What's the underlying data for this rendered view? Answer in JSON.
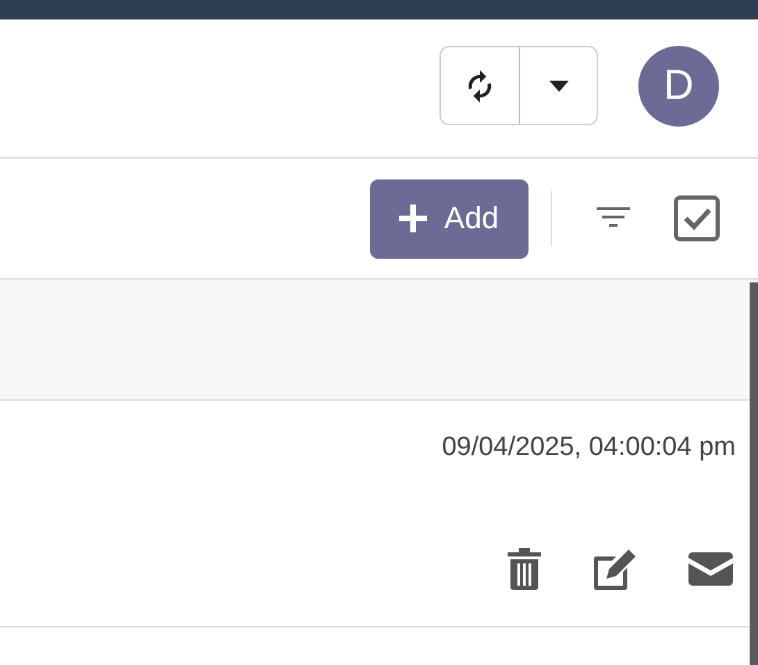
{
  "header": {
    "avatar": "D"
  },
  "toolbar": {
    "add_button": "Add"
  },
  "table": {
    "rows": [
      {
        "timestamp": "09/04/2025, 04:00:04 pm"
      }
    ]
  }
}
